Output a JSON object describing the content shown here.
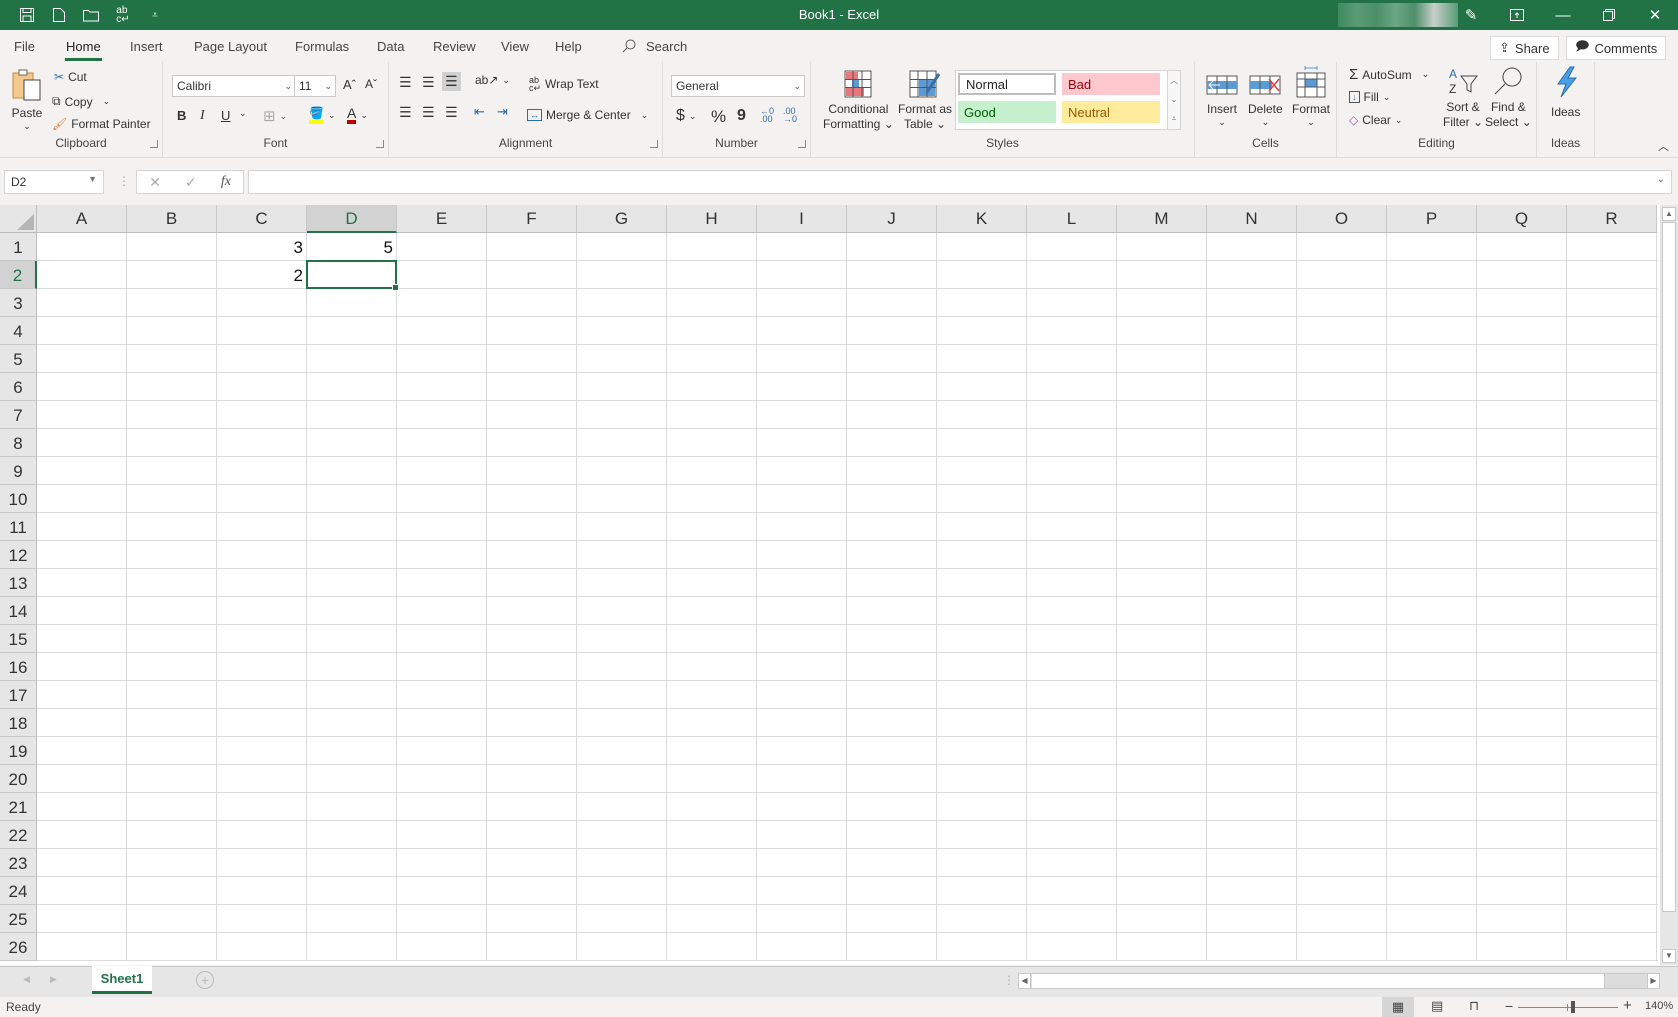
{
  "window": {
    "title": "Book1  -  Excel",
    "qat_icons": [
      "save-icon",
      "new-file-icon",
      "open-folder-icon",
      "spelling-icon",
      "customize-qat-icon"
    ],
    "controls": [
      "pen-icon",
      "ribbon-display-icon",
      "minimize-icon",
      "restore-icon",
      "close-icon"
    ]
  },
  "tabs": [
    "File",
    "Home",
    "Insert",
    "Page Layout",
    "Formulas",
    "Data",
    "Review",
    "View",
    "Help"
  ],
  "active_tab": "Home",
  "search_label": "Search",
  "share_label": "Share",
  "comments_label": "Comments",
  "ribbon": {
    "clipboard": {
      "label": "Clipboard",
      "paste": "Paste",
      "cut": "Cut",
      "copy": "Copy",
      "format_painter": "Format Painter"
    },
    "font": {
      "label": "Font",
      "font_name": "Calibri",
      "font_size": "11",
      "bold": "B",
      "italic": "I",
      "underline": "U",
      "fill_color": "#ffff00",
      "font_color": "#c00000"
    },
    "alignment": {
      "label": "Alignment",
      "wrap_text": "Wrap Text",
      "merge_center": "Merge & Center"
    },
    "number": {
      "label": "Number",
      "format": "General",
      "currency": "$",
      "percent": "%",
      "comma": "9"
    },
    "styles": {
      "label": "Styles",
      "conditional_1": "Conditional",
      "conditional_2": "Formatting",
      "format_table_1": "Format as",
      "format_table_2": "Table",
      "cells": [
        {
          "name": "Normal",
          "bg": "#ffffff",
          "fg": "#000000"
        },
        {
          "name": "Bad",
          "bg": "#ffc7ce",
          "fg": "#9c0006"
        },
        {
          "name": "Good",
          "bg": "#c6efce",
          "fg": "#006100"
        },
        {
          "name": "Neutral",
          "bg": "#ffeb9c",
          "fg": "#9c5700"
        }
      ]
    },
    "cells": {
      "label": "Cells",
      "insert": "Insert",
      "delete": "Delete",
      "format": "Format"
    },
    "editing": {
      "label": "Editing",
      "autosum": "AutoSum",
      "fill": "Fill",
      "clear": "Clear",
      "sort_1": "Sort &",
      "sort_2": "Filter",
      "find_1": "Find &",
      "find_2": "Select"
    },
    "ideas": {
      "label": "Ideas",
      "ideas": "Ideas"
    }
  },
  "formula_bar": {
    "name_box": "D2",
    "fx": "fx",
    "formula": ""
  },
  "sheet": {
    "columns": [
      "A",
      "B",
      "C",
      "D",
      "E",
      "F",
      "G",
      "H",
      "I",
      "J",
      "K",
      "L",
      "M",
      "N",
      "O",
      "P",
      "Q",
      "R"
    ],
    "rows": [
      "1",
      "2",
      "3",
      "4",
      "5",
      "6",
      "7",
      "8",
      "9",
      "10",
      "11",
      "12",
      "13",
      "14",
      "15",
      "16",
      "17",
      "18",
      "19",
      "20",
      "21",
      "22",
      "23",
      "24",
      "25",
      "26"
    ],
    "selected_cell": "D2",
    "cells": [
      {
        "ref": "C1",
        "value": "3"
      },
      {
        "ref": "D1",
        "value": "5"
      },
      {
        "ref": "C2",
        "value": "2"
      }
    ]
  },
  "sheet_tabs": [
    "Sheet1"
  ],
  "status": {
    "text": "Ready",
    "zoom": "140%",
    "zoom_fraction": 0.55
  }
}
